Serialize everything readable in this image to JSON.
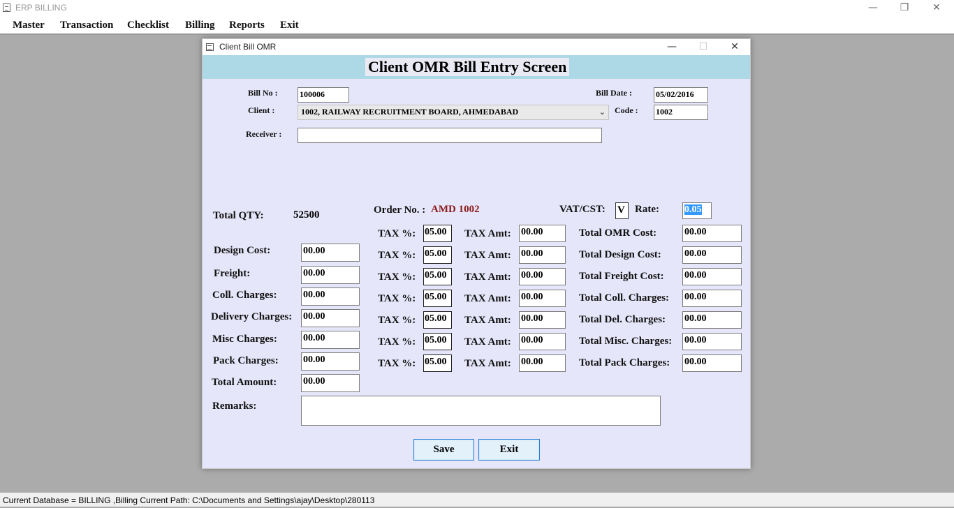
{
  "app": {
    "title": "ERP BILLING",
    "window_controls": {
      "minimize": "—",
      "restore": "❐",
      "close": "✕"
    }
  },
  "menu": [
    "Master",
    "Transaction",
    "Checklist",
    "Billing",
    "Reports",
    "Exit"
  ],
  "status": "Current Database = BILLING  ,Billing Current Path: C:\\Documents and Settings\\ajay\\Desktop\\280113",
  "dialog": {
    "title": "Client Bill OMR",
    "controls": {
      "minimize": "—",
      "maximize": "☐",
      "close": "✕"
    },
    "header": "Client OMR Bill Entry Screen",
    "bill_no_label": "Bill No :",
    "bill_no": "100006",
    "bill_date_label": "Bill Date :",
    "bill_date": "05/02/2016",
    "client_label": "Client :",
    "client": "1002, RAILWAY RECRUITMENT BOARD, AHMEDABAD",
    "code_label": "Code :",
    "code": "1002",
    "receiver_label": "Receiver :",
    "receiver": "",
    "total_qty_label": "Total QTY:",
    "total_qty": "52500",
    "order_no_label": "Order No. :",
    "order_no": "AMD 1002",
    "vat_label": "VAT/CST:",
    "vat": "V",
    "rate_label": "Rate:",
    "rate": "0.05",
    "tax_pct_label": "TAX %:",
    "tax_amt_label": "TAX Amt:",
    "omr_row": {
      "tax_pct": "05.00",
      "tax_amt": "00.00",
      "total_label": "Total OMR Cost:",
      "total": "00.00"
    },
    "charges": [
      {
        "label": "Design Cost:",
        "value": "00.00",
        "tax_pct": "05.00",
        "tax_amt": "00.00",
        "total_label": "Total Design Cost:",
        "total": "00.00"
      },
      {
        "label": "Freight:",
        "value": "00.00",
        "tax_pct": "05.00",
        "tax_amt": "00.00",
        "total_label": "Total Freight Cost:",
        "total": "00.00"
      },
      {
        "label": "Coll. Charges:",
        "value": "00.00",
        "tax_pct": "05.00",
        "tax_amt": "00.00",
        "total_label": "Total Coll. Charges:",
        "total": "00.00"
      },
      {
        "label": "Delivery Charges:",
        "value": "00.00",
        "tax_pct": "05.00",
        "tax_amt": "00.00",
        "total_label": "Total Del. Charges:",
        "total": "00.00"
      },
      {
        "label": "Misc Charges:",
        "value": "00.00",
        "tax_pct": "05.00",
        "tax_amt": "00.00",
        "total_label": "Total Misc. Charges:",
        "total": "00.00"
      },
      {
        "label": "Pack Charges:",
        "value": "00.00",
        "tax_pct": "05.00",
        "tax_amt": "00.00",
        "total_label": "Total Pack Charges:",
        "total": "00.00"
      }
    ],
    "total_amount_label": "Total Amount:",
    "total_amount": "00.00",
    "remarks_label": "Remarks:",
    "remarks": "",
    "save_label": "Save",
    "exit_label": "Exit"
  },
  "colors": {
    "header_band": "#add8e6",
    "form_bg": "#e6e6fa",
    "order_no": "#8b1a1a",
    "mdi_bg": "#ababab"
  }
}
